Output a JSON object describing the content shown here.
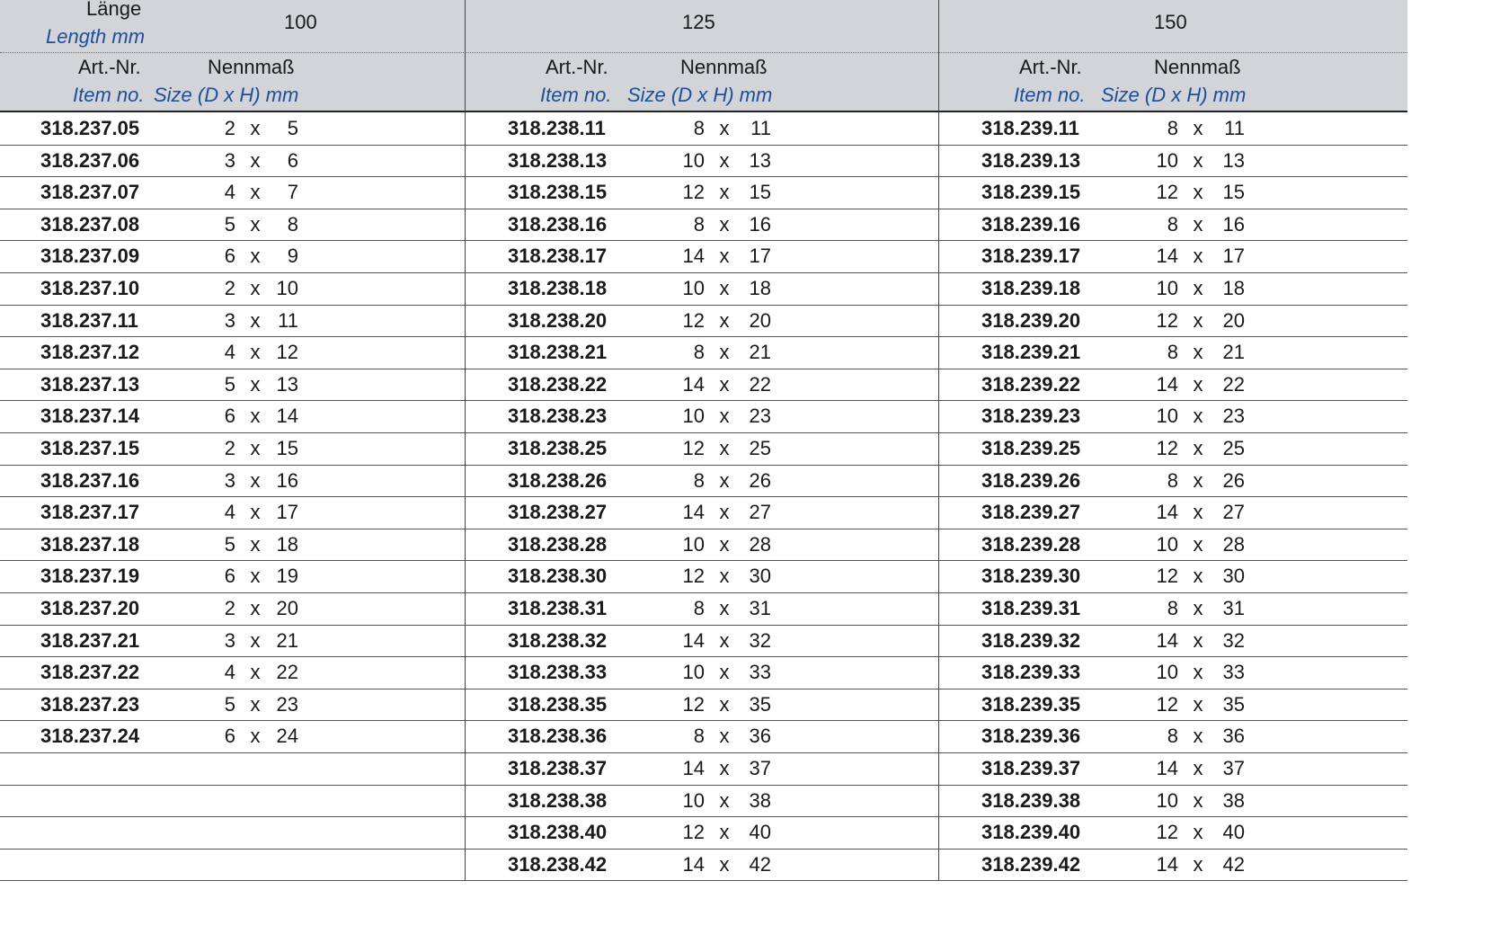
{
  "header": {
    "length_de": "Länge",
    "length_en": "Length mm",
    "groups": [
      "100",
      "125",
      "150"
    ],
    "artnr_de": "Art.-Nr.",
    "itemno_en": "Item no.",
    "size_de": "Nennmaß",
    "size_en": "Size (D x H) mm"
  },
  "separator": "x",
  "groups": [
    {
      "length": "100",
      "rows": [
        {
          "item": "318.237.05",
          "d": "2",
          "h": "5"
        },
        {
          "item": "318.237.06",
          "d": "3",
          "h": "6"
        },
        {
          "item": "318.237.07",
          "d": "4",
          "h": "7"
        },
        {
          "item": "318.237.08",
          "d": "5",
          "h": "8"
        },
        {
          "item": "318.237.09",
          "d": "6",
          "h": "9"
        },
        {
          "item": "318.237.10",
          "d": "2",
          "h": "10"
        },
        {
          "item": "318.237.11",
          "d": "3",
          "h": "11"
        },
        {
          "item": "318.237.12",
          "d": "4",
          "h": "12"
        },
        {
          "item": "318.237.13",
          "d": "5",
          "h": "13"
        },
        {
          "item": "318.237.14",
          "d": "6",
          "h": "14"
        },
        {
          "item": "318.237.15",
          "d": "2",
          "h": "15"
        },
        {
          "item": "318.237.16",
          "d": "3",
          "h": "16"
        },
        {
          "item": "318.237.17",
          "d": "4",
          "h": "17"
        },
        {
          "item": "318.237.18",
          "d": "5",
          "h": "18"
        },
        {
          "item": "318.237.19",
          "d": "6",
          "h": "19"
        },
        {
          "item": "318.237.20",
          "d": "2",
          "h": "20"
        },
        {
          "item": "318.237.21",
          "d": "3",
          "h": "21"
        },
        {
          "item": "318.237.22",
          "d": "4",
          "h": "22"
        },
        {
          "item": "318.237.23",
          "d": "5",
          "h": "23"
        },
        {
          "item": "318.237.24",
          "d": "6",
          "h": "24"
        }
      ]
    },
    {
      "length": "125",
      "rows": [
        {
          "item": "318.238.11",
          "d": "8",
          "h": "11"
        },
        {
          "item": "318.238.13",
          "d": "10",
          "h": "13"
        },
        {
          "item": "318.238.15",
          "d": "12",
          "h": "15"
        },
        {
          "item": "318.238.16",
          "d": "8",
          "h": "16"
        },
        {
          "item": "318.238.17",
          "d": "14",
          "h": "17"
        },
        {
          "item": "318.238.18",
          "d": "10",
          "h": "18"
        },
        {
          "item": "318.238.20",
          "d": "12",
          "h": "20"
        },
        {
          "item": "318.238.21",
          "d": "8",
          "h": "21"
        },
        {
          "item": "318.238.22",
          "d": "14",
          "h": "22"
        },
        {
          "item": "318.238.23",
          "d": "10",
          "h": "23"
        },
        {
          "item": "318.238.25",
          "d": "12",
          "h": "25"
        },
        {
          "item": "318.238.26",
          "d": "8",
          "h": "26"
        },
        {
          "item": "318.238.27",
          "d": "14",
          "h": "27"
        },
        {
          "item": "318.238.28",
          "d": "10",
          "h": "28"
        },
        {
          "item": "318.238.30",
          "d": "12",
          "h": "30"
        },
        {
          "item": "318.238.31",
          "d": "8",
          "h": "31"
        },
        {
          "item": "318.238.32",
          "d": "14",
          "h": "32"
        },
        {
          "item": "318.238.33",
          "d": "10",
          "h": "33"
        },
        {
          "item": "318.238.35",
          "d": "12",
          "h": "35"
        },
        {
          "item": "318.238.36",
          "d": "8",
          "h": "36"
        },
        {
          "item": "318.238.37",
          "d": "14",
          "h": "37"
        },
        {
          "item": "318.238.38",
          "d": "10",
          "h": "38"
        },
        {
          "item": "318.238.40",
          "d": "12",
          "h": "40"
        },
        {
          "item": "318.238.42",
          "d": "14",
          "h": "42"
        }
      ]
    },
    {
      "length": "150",
      "rows": [
        {
          "item": "318.239.11",
          "d": "8",
          "h": "11"
        },
        {
          "item": "318.239.13",
          "d": "10",
          "h": "13"
        },
        {
          "item": "318.239.15",
          "d": "12",
          "h": "15"
        },
        {
          "item": "318.239.16",
          "d": "8",
          "h": "16"
        },
        {
          "item": "318.239.17",
          "d": "14",
          "h": "17"
        },
        {
          "item": "318.239.18",
          "d": "10",
          "h": "18"
        },
        {
          "item": "318.239.20",
          "d": "12",
          "h": "20"
        },
        {
          "item": "318.239.21",
          "d": "8",
          "h": "21"
        },
        {
          "item": "318.239.22",
          "d": "14",
          "h": "22"
        },
        {
          "item": "318.239.23",
          "d": "10",
          "h": "23"
        },
        {
          "item": "318.239.25",
          "d": "12",
          "h": "25"
        },
        {
          "item": "318.239.26",
          "d": "8",
          "h": "26"
        },
        {
          "item": "318.239.27",
          "d": "14",
          "h": "27"
        },
        {
          "item": "318.239.28",
          "d": "10",
          "h": "28"
        },
        {
          "item": "318.239.30",
          "d": "12",
          "h": "30"
        },
        {
          "item": "318.239.31",
          "d": "8",
          "h": "31"
        },
        {
          "item": "318.239.32",
          "d": "14",
          "h": "32"
        },
        {
          "item": "318.239.33",
          "d": "10",
          "h": "33"
        },
        {
          "item": "318.239.35",
          "d": "12",
          "h": "35"
        },
        {
          "item": "318.239.36",
          "d": "8",
          "h": "36"
        },
        {
          "item": "318.239.37",
          "d": "14",
          "h": "37"
        },
        {
          "item": "318.239.38",
          "d": "10",
          "h": "38"
        },
        {
          "item": "318.239.40",
          "d": "12",
          "h": "40"
        },
        {
          "item": "318.239.42",
          "d": "14",
          "h": "42"
        }
      ]
    }
  ]
}
